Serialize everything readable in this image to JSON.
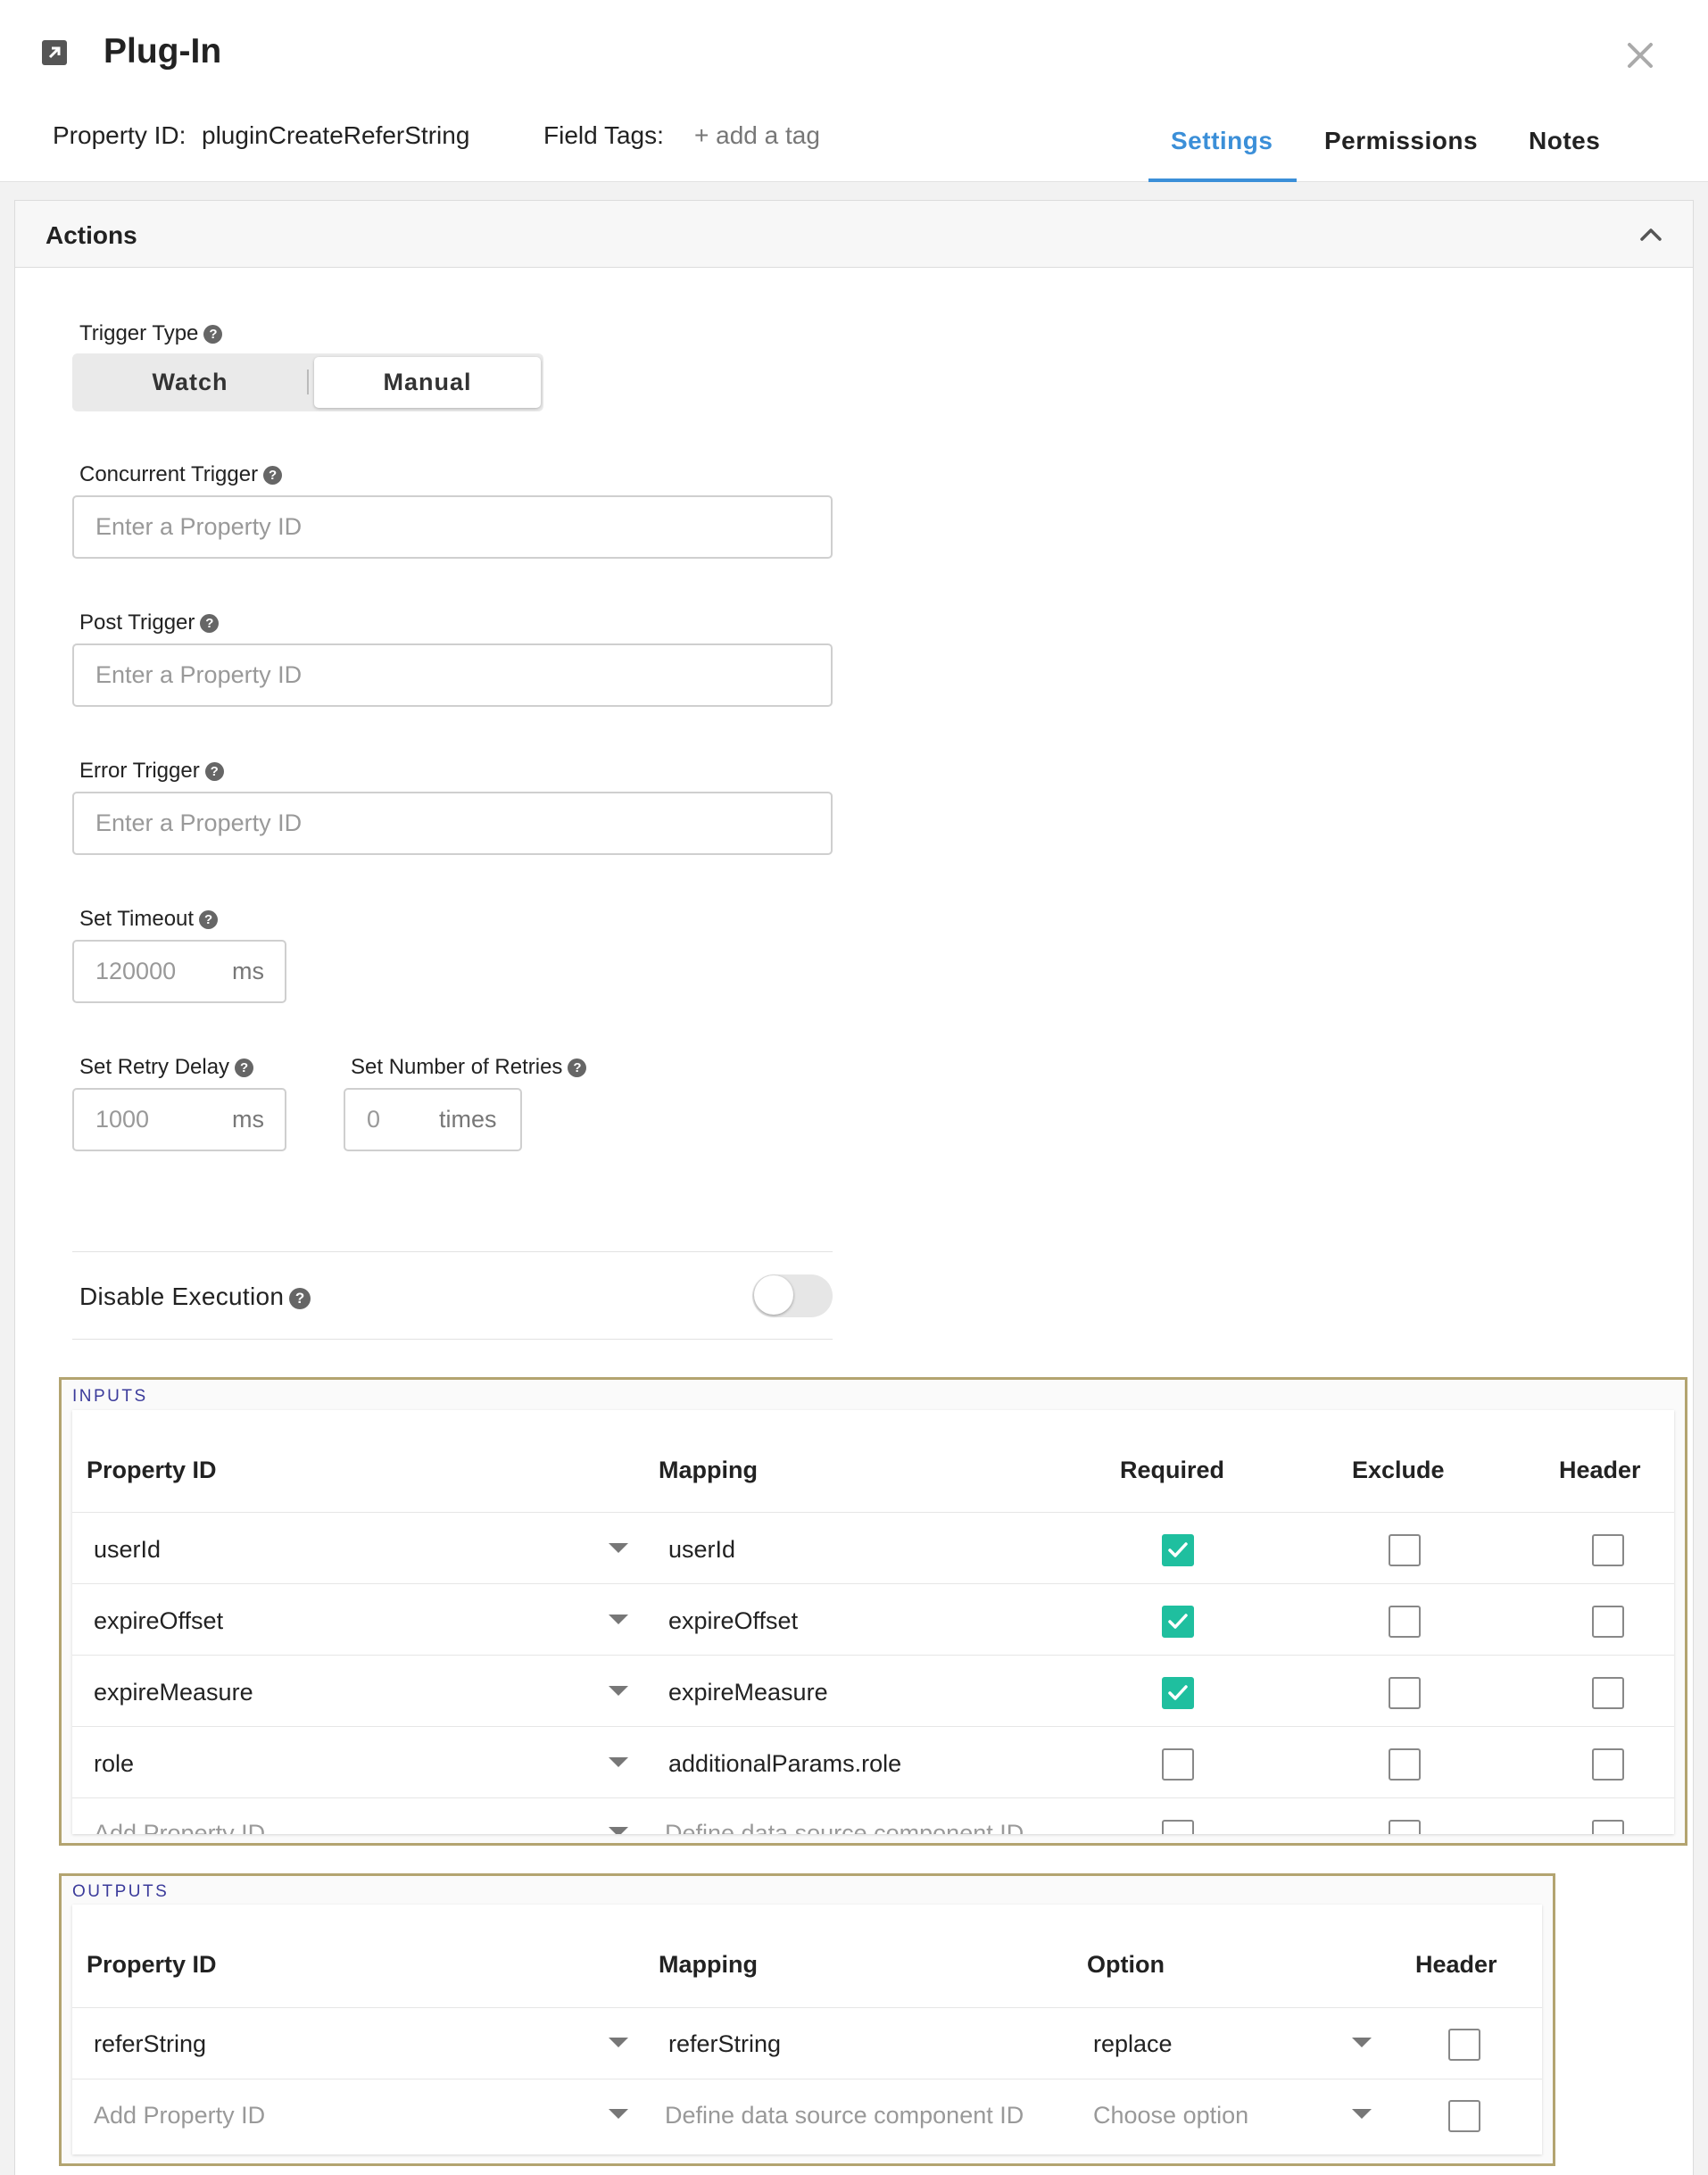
{
  "header": {
    "title": "Plug-In",
    "property_id_label": "Property ID:",
    "property_id_value": "pluginCreateReferString",
    "field_tags_label": "Field Tags:",
    "add_tag": "+ add a tag",
    "tabs": [
      {
        "label": "Settings",
        "active": true
      },
      {
        "label": "Permissions",
        "active": false
      },
      {
        "label": "Notes",
        "active": false
      }
    ]
  },
  "panel": {
    "title": "Actions",
    "trigger_type": {
      "label": "Trigger Type",
      "options": [
        "Watch",
        "Manual"
      ],
      "selected": "Manual"
    },
    "concurrent_trigger": {
      "label": "Concurrent Trigger",
      "placeholder": "Enter a Property ID"
    },
    "post_trigger": {
      "label": "Post Trigger",
      "placeholder": "Enter a Property ID"
    },
    "error_trigger": {
      "label": "Error Trigger",
      "placeholder": "Enter a Property ID"
    },
    "timeout": {
      "label": "Set Timeout",
      "value": "120000",
      "unit": "ms"
    },
    "retry_delay": {
      "label": "Set Retry Delay",
      "value": "1000",
      "unit": "ms"
    },
    "retries": {
      "label": "Set Number of Retries",
      "value": "0",
      "unit": "times"
    },
    "disable_execution": {
      "label": "Disable Execution",
      "enabled": false
    }
  },
  "inputs": {
    "section_label": "INPUTS",
    "columns": [
      "Property ID",
      "Mapping",
      "Required",
      "Exclude",
      "Header"
    ],
    "rows": [
      {
        "property_id": "userId",
        "mapping": "userId",
        "required": true,
        "exclude": false,
        "header": false
      },
      {
        "property_id": "expireOffset",
        "mapping": "expireOffset",
        "required": true,
        "exclude": false,
        "header": false
      },
      {
        "property_id": "expireMeasure",
        "mapping": "expireMeasure",
        "required": true,
        "exclude": false,
        "header": false
      },
      {
        "property_id": "role",
        "mapping": "additionalParams.role",
        "required": false,
        "exclude": false,
        "header": false
      }
    ],
    "add_row": {
      "property_id_placeholder": "Add Property ID",
      "mapping_placeholder": "Define data source component ID"
    }
  },
  "outputs": {
    "section_label": "OUTPUTS",
    "columns": [
      "Property ID",
      "Mapping",
      "Option",
      "Header"
    ],
    "rows": [
      {
        "property_id": "referString",
        "mapping": "referString",
        "option": "replace",
        "header": false
      }
    ],
    "add_row": {
      "property_id_placeholder": "Add Property ID",
      "mapping_placeholder": "Define data source component ID",
      "option_placeholder": "Choose option"
    }
  },
  "help_glyph": "?",
  "colors": {
    "accent": "#3b8fd8",
    "checked": "#1fbf9f",
    "highlight_border": "#b3a470"
  }
}
